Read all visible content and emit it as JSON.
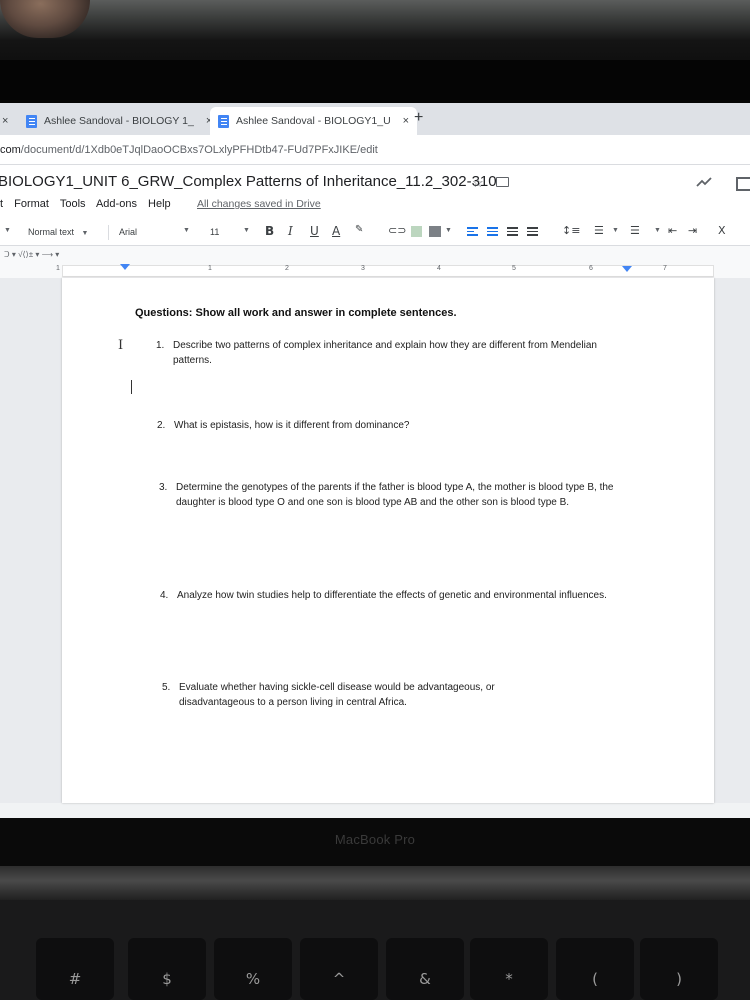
{
  "browser": {
    "tabs": [
      {
        "label": "Ashlee Sandoval - BIOLOGY 1_",
        "active": false,
        "close": "×"
      },
      {
        "label": "Ashlee Sandoval - BIOLOGY1_U",
        "active": true,
        "close": "×"
      }
    ],
    "stray_close": "×",
    "new_tab": "+",
    "url_prefix": "com",
    "url_path": "/document/d/1Xdb0eTJqlDaoOCBxs7OLxlyPFHDtb47-FUd7PFxJIKE/edit"
  },
  "docs": {
    "title": "BIOLOGY1_UNIT 6_GRW_Complex Patterns of Inheritance_11.2_302-310",
    "menu": [
      "t",
      "Format",
      "Tools",
      "Add-ons",
      "Help"
    ],
    "save_status": "All changes saved in Drive",
    "toolbar": {
      "style": "Normal text",
      "font": "Arial",
      "size": "11",
      "bold": "B",
      "italic": "I",
      "underline": "U",
      "text_color": "A",
      "clear": "X"
    },
    "ruler_numbers": [
      "1",
      "1",
      "2",
      "3",
      "4",
      "5",
      "6",
      "7"
    ]
  },
  "document": {
    "heading": "Questions: Show all work and answer in complete sentences.",
    "questions": [
      {
        "num": "1.",
        "text": "Describe two patterns of complex inheritance and explain how they are different from Mendelian patterns."
      },
      {
        "num": "2.",
        "text": "What is epistasis, how is it different from dominance?"
      },
      {
        "num": "3.",
        "text": "Determine the genotypes of the parents if the father is blood type A, the mother is blood type B, the daughter is blood type O and one son is blood type AB and the other son is blood type B."
      },
      {
        "num": "4.",
        "text": "Analyze how twin studies help to differentiate the effects of genetic and environmental influences."
      },
      {
        "num": "5.",
        "text": "Evaluate whether having sickle-cell disease would be advantageous, or disadvantageous to a person living in central Africa."
      }
    ]
  },
  "hardware": {
    "laptop_label": "MacBook Pro",
    "keys": [
      "#",
      "$",
      "%",
      "^",
      "&",
      "*",
      "(",
      ")"
    ]
  },
  "colors": {
    "docs_blue": "#4285f4",
    "tab_bar": "#dee1e6",
    "canvas": "#e9ebee"
  }
}
